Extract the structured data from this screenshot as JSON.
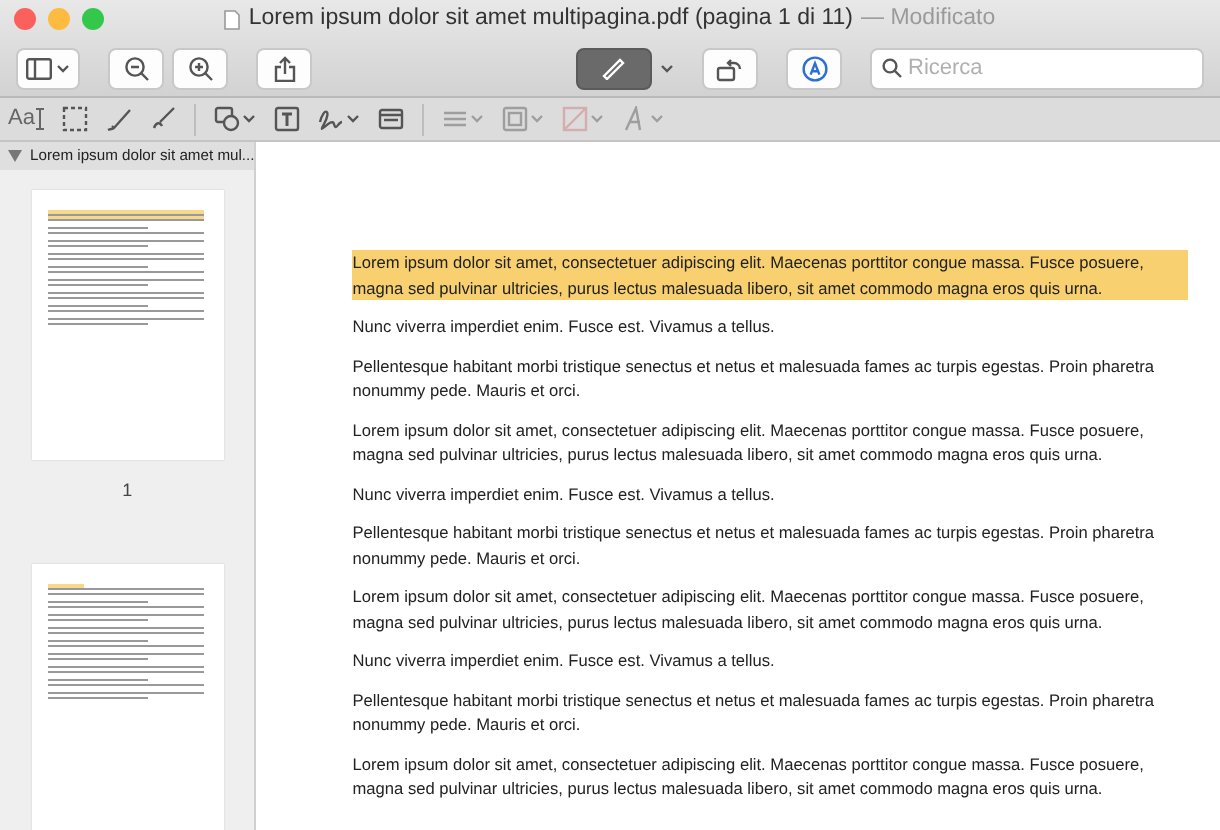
{
  "window": {
    "title": "Lorem ipsum dolor sit amet multipagina.pdf (pagina 1 di 11)",
    "status": "— Modificato"
  },
  "toolbar": {
    "search": {
      "placeholder": "Ricerca"
    },
    "markup_selected": true
  },
  "markup_tools": [
    {
      "kind": "text-style",
      "label": "Aa",
      "disabled": false
    },
    {
      "kind": "selection",
      "disabled": false
    },
    {
      "kind": "sketch",
      "disabled": false
    },
    {
      "kind": "draw",
      "disabled": false
    },
    {
      "kind": "shapes",
      "disabled": false
    },
    {
      "kind": "text",
      "disabled": false
    },
    {
      "kind": "sign",
      "disabled": false
    },
    {
      "kind": "note",
      "disabled": false
    },
    {
      "kind": "shape-style",
      "disabled": true
    },
    {
      "kind": "border",
      "disabled": true
    },
    {
      "kind": "fill",
      "disabled": true
    },
    {
      "kind": "font",
      "disabled": true
    }
  ],
  "sidebar": {
    "header": "Lorem ipsum dolor sit amet mul...",
    "expanded": true,
    "pages": [
      {
        "number": "1",
        "selected": false
      },
      {
        "selected": false
      }
    ]
  },
  "document": {
    "paragraphs": [
      {
        "text": "Lorem ipsum dolor sit amet, consectetuer adipiscing elit. Maecenas porttitor congue massa. Fusce posuere, magna sed pulvinar ultricies, purus lectus malesuada libero, sit amet commodo magna eros quis urna.",
        "highlighted": true
      },
      {
        "text": "Nunc viverra imperdiet enim. Fusce est. Vivamus a tellus.",
        "highlighted": false
      },
      {
        "text": "Pellentesque habitant morbi tristique senectus et netus et malesuada fames ac turpis egestas. Proin pharetra nonummy pede. Mauris et orci.",
        "highlighted": false
      },
      {
        "text": "Lorem ipsum dolor sit amet, consectetuer adipiscing elit. Maecenas porttitor congue massa. Fusce posuere, magna sed pulvinar ultricies, purus lectus malesuada libero, sit amet commodo magna eros quis urna.",
        "highlighted": false
      },
      {
        "text": "Nunc viverra imperdiet enim. Fusce est. Vivamus a tellus.",
        "highlighted": false
      },
      {
        "text": "Pellentesque habitant morbi tristique senectus et netus et malesuada fames ac turpis egestas. Proin pharetra nonummy pede. Mauris et orci.",
        "highlighted": false
      },
      {
        "text": "Lorem ipsum dolor sit amet, consectetuer adipiscing elit. Maecenas porttitor congue massa. Fusce posuere, magna sed pulvinar ultricies, purus lectus malesuada libero, sit amet commodo magna eros quis urna.",
        "highlighted": false
      },
      {
        "text": "Nunc viverra imperdiet enim. Fusce est. Vivamus a tellus.",
        "highlighted": false
      },
      {
        "text": "Pellentesque habitant morbi tristique senectus et netus et malesuada fames ac turpis egestas. Proin pharetra nonummy pede. Mauris et orci.",
        "highlighted": false
      },
      {
        "text": "Lorem ipsum dolor sit amet, consectetuer adipiscing elit. Maecenas porttitor congue massa. Fusce posuere, magna sed pulvinar ultricies, purus lectus malesuada libero, sit amet commodo magna eros quis urna.",
        "highlighted": false
      }
    ]
  }
}
